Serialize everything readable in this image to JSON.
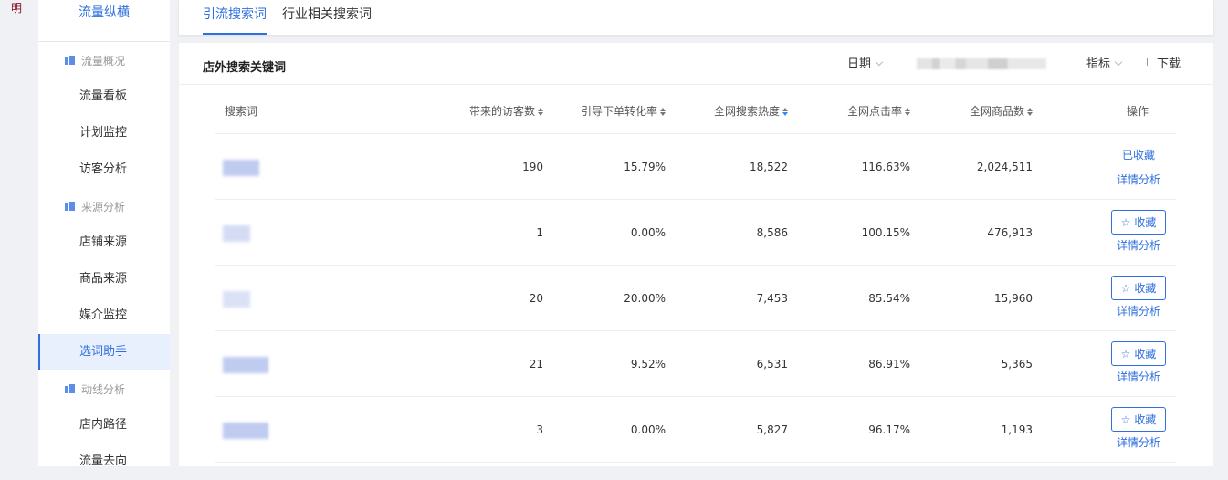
{
  "corner_text": "明",
  "sidebar": {
    "title": "流量纵横",
    "sections": [
      {
        "group": "流量概况",
        "items": [
          "流量看板",
          "计划监控",
          "访客分析"
        ]
      },
      {
        "group": "来源分析",
        "items": [
          "店铺来源",
          "商品来源",
          "媒介监控",
          "选词助手"
        ]
      },
      {
        "group": "动线分析",
        "items": [
          "店内路径",
          "流量去向"
        ]
      }
    ],
    "active_item": "选词助手"
  },
  "tabs": [
    {
      "label": "引流搜索词",
      "active": true
    },
    {
      "label": "行业相关搜索词",
      "active": false
    }
  ],
  "panel": {
    "title": "店外搜索关键词",
    "date_label": "日期",
    "metric_label": "指标",
    "download_label": "下载"
  },
  "table": {
    "headers": {
      "keyword": "搜索词",
      "visitors": "带来的访客数",
      "conversion": "引导下单转化率",
      "heat": "全网搜索热度",
      "ctr": "全网点击率",
      "goods": "全网商品数",
      "ops": "操作"
    },
    "rows": [
      {
        "visitors": "190",
        "conversion": "15.79%",
        "heat": "18,522",
        "ctr": "116.63%",
        "goods": "2,024,511",
        "collected": true
      },
      {
        "visitors": "1",
        "conversion": "0.00%",
        "heat": "8,586",
        "ctr": "100.15%",
        "goods": "476,913",
        "collected": false
      },
      {
        "visitors": "20",
        "conversion": "20.00%",
        "heat": "7,453",
        "ctr": "85.54%",
        "goods": "15,960",
        "collected": false
      },
      {
        "visitors": "21",
        "conversion": "9.52%",
        "heat": "6,531",
        "ctr": "86.91%",
        "goods": "5,365",
        "collected": false
      },
      {
        "visitors": "3",
        "conversion": "0.00%",
        "heat": "5,827",
        "ctr": "96.17%",
        "goods": "1,193",
        "collected": false
      }
    ],
    "collected_label": "已收藏",
    "collect_label": "收藏",
    "detail_label": "详情分析"
  },
  "colors": {
    "accent": "#2f6fde",
    "active_bg": "#e8f0fd"
  },
  "icons": {
    "group": "building-icon",
    "star": "star-icon",
    "download": "download-icon"
  }
}
